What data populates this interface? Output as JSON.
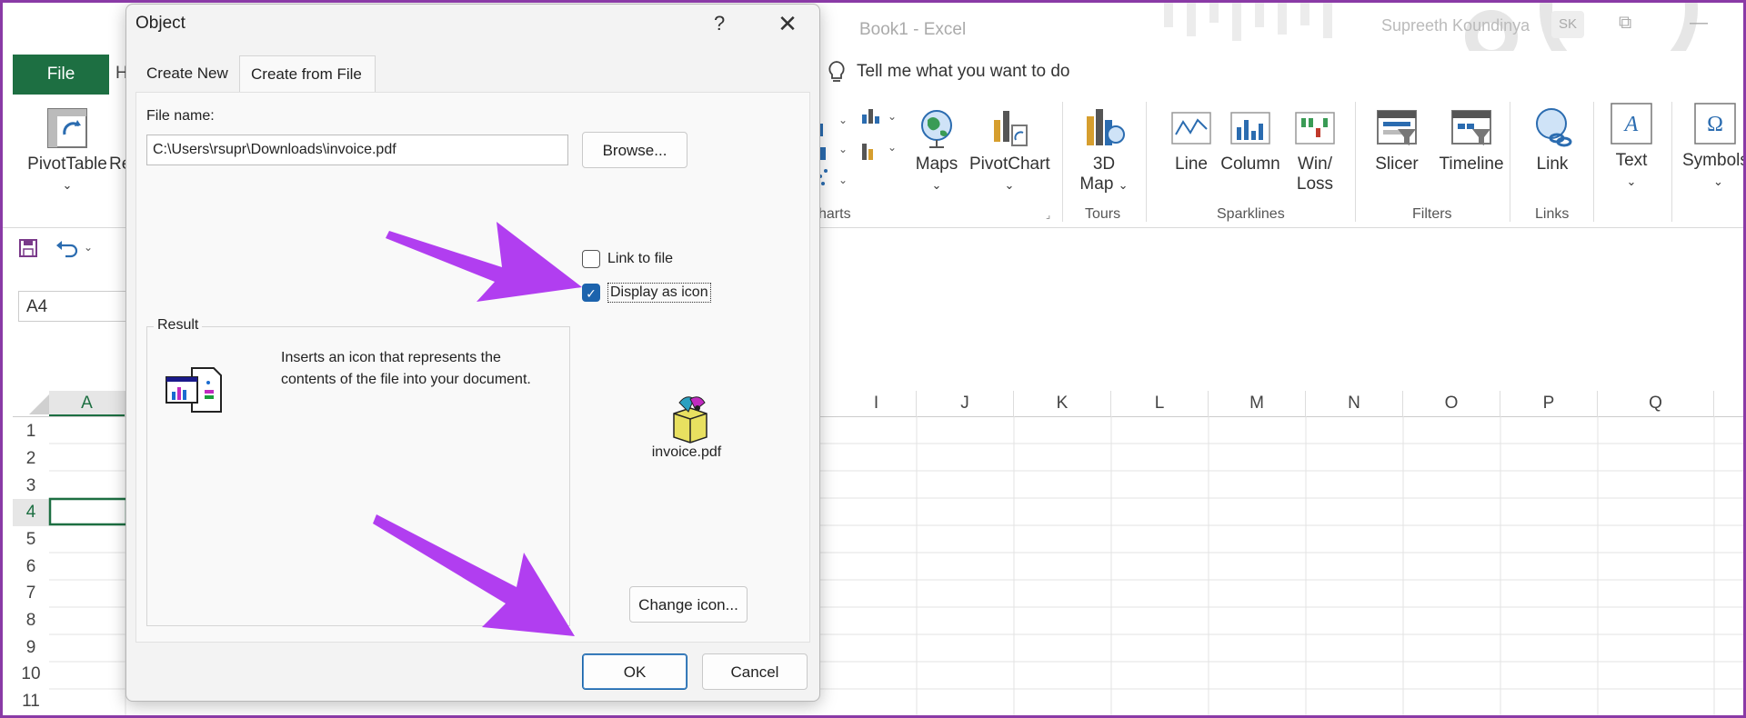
{
  "window": {
    "title": "Book1  -  Excel",
    "user_name": "Supreeth Koundinya",
    "user_initials": "SK",
    "restore_glyph": "⧉",
    "minimize_glyph": "—"
  },
  "ribbon_tabs": {
    "file": "File",
    "home_partial": "H"
  },
  "tell_me": "Tell me what you want to do",
  "ribbon": {
    "pivottable": "PivotTable",
    "recommended_partial": "Re",
    "maps": "Maps",
    "pivotchart": "PivotChart",
    "map3d_line1": "3D",
    "map3d_line2": "Map",
    "line": "Line",
    "column": "Column",
    "winloss_line1": "Win/",
    "winloss_line2": "Loss",
    "slicer": "Slicer",
    "timeline": "Timeline",
    "link": "Link",
    "text": "Text",
    "symbols": "Symbols",
    "groups": {
      "charts_partial": "harts",
      "tours": "Tours",
      "sparklines": "Sparklines",
      "filters": "Filters",
      "links": "Links"
    }
  },
  "name_box": "A4",
  "columns_left": [
    "A"
  ],
  "columns_right": [
    "I",
    "J",
    "K",
    "L",
    "M",
    "N",
    "O",
    "P",
    "Q"
  ],
  "rows": [
    "1",
    "2",
    "3",
    "4",
    "5",
    "6",
    "7",
    "8",
    "9",
    "10",
    "11"
  ],
  "dialog": {
    "title": "Object",
    "help": "?",
    "close": "✕",
    "tabs": [
      {
        "label": "Create New",
        "active": false
      },
      {
        "label": "Create from File",
        "active": true
      }
    ],
    "file_name_label": "File name:",
    "file_name_value": "C:\\Users\\rsupr\\Downloads\\invoice.pdf",
    "browse_label": "Browse...",
    "link_to_file_label": "Link to file",
    "link_to_file_checked": false,
    "display_as_icon_label": "Display as icon",
    "display_as_icon_checked": true,
    "result_title": "Result",
    "result_text": "Inserts an icon that represents the contents of the file into your document.",
    "file_icon_caption": "invoice.pdf",
    "change_icon_label": "Change icon...",
    "ok_label": "OK",
    "cancel_label": "Cancel"
  },
  "colors": {
    "excel_green": "#1d6f42",
    "annotation_arrow": "#b13ef0",
    "checkbox_blue": "#1c63ad",
    "frame_border": "#8a3aa6"
  }
}
